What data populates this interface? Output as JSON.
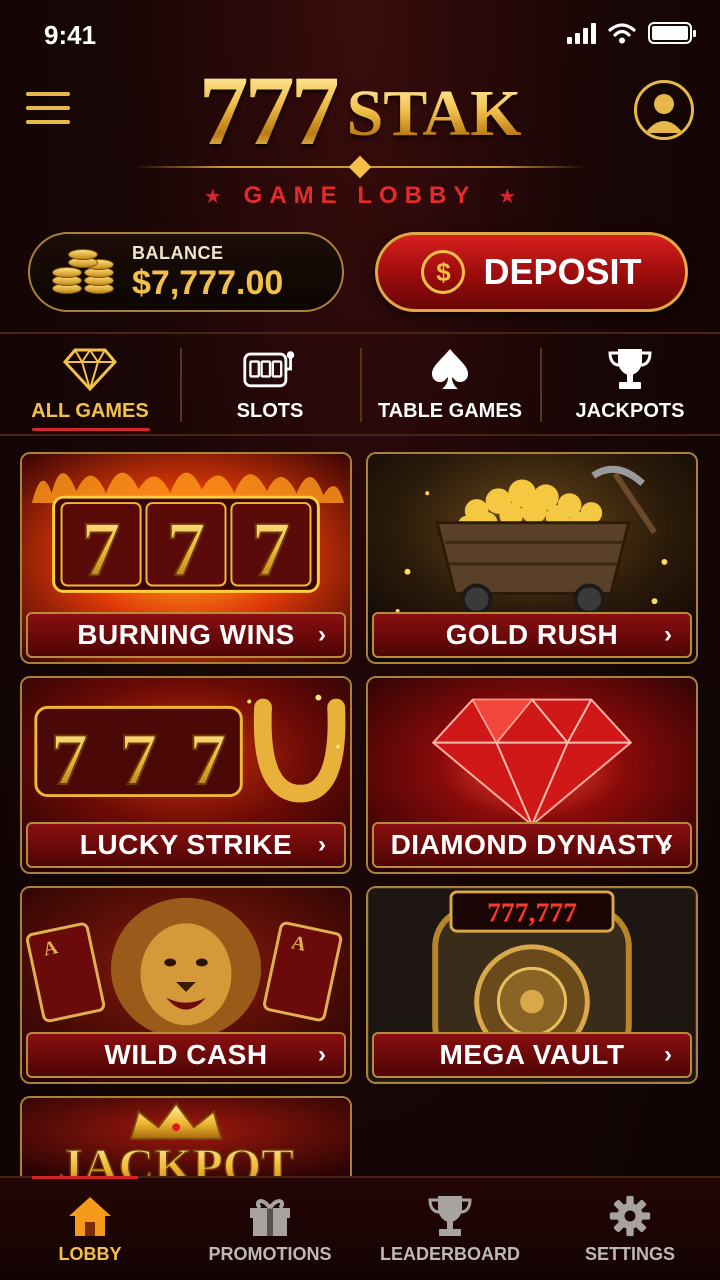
{
  "status_bar": {
    "time": "9:41"
  },
  "header": {
    "logo_number": "777",
    "logo_word": "STAK",
    "subtitle": "GAME LOBBY"
  },
  "balance": {
    "label": "BALANCE",
    "value": "$7,777.00"
  },
  "deposit": {
    "label": "DEPOSIT",
    "icon": "dollar-coin-icon"
  },
  "tabs": [
    {
      "label": "ALL GAMES",
      "icon": "diamond-icon",
      "active": true
    },
    {
      "label": "SLOTS",
      "icon": "slot-machine-icon",
      "active": false
    },
    {
      "label": "TABLE GAMES",
      "icon": "spade-icon",
      "active": false
    },
    {
      "label": "JACKPOTS",
      "icon": "trophy-icon",
      "active": false
    }
  ],
  "games": [
    {
      "title": "BURNING WINS",
      "art": "flaming-777-reels"
    },
    {
      "title": "GOLD RUSH",
      "art": "gold-mine-cart"
    },
    {
      "title": "LUCKY STRIKE",
      "art": "777-horseshoe"
    },
    {
      "title": "DIAMOND DYNASTY",
      "art": "red-diamond"
    },
    {
      "title": "WILD CASH",
      "art": "lion-with-aces"
    },
    {
      "title": "MEGA VAULT",
      "art": "vault-door",
      "counter": "777,777"
    },
    {
      "title": "",
      "art": "crown-jackpot",
      "banner": "JACKPOT"
    }
  ],
  "bottom_nav": [
    {
      "label": "LOBBY",
      "icon": "home-icon",
      "active": true
    },
    {
      "label": "PROMOTIONS",
      "icon": "gift-icon",
      "active": false
    },
    {
      "label": "LEADERBOARD",
      "icon": "trophy-icon",
      "active": false
    },
    {
      "label": "SETTINGS",
      "icon": "gear-icon",
      "active": false
    }
  ],
  "colors": {
    "gold": "#f3c14a",
    "red": "#d3262a",
    "background": "#1a0606"
  }
}
